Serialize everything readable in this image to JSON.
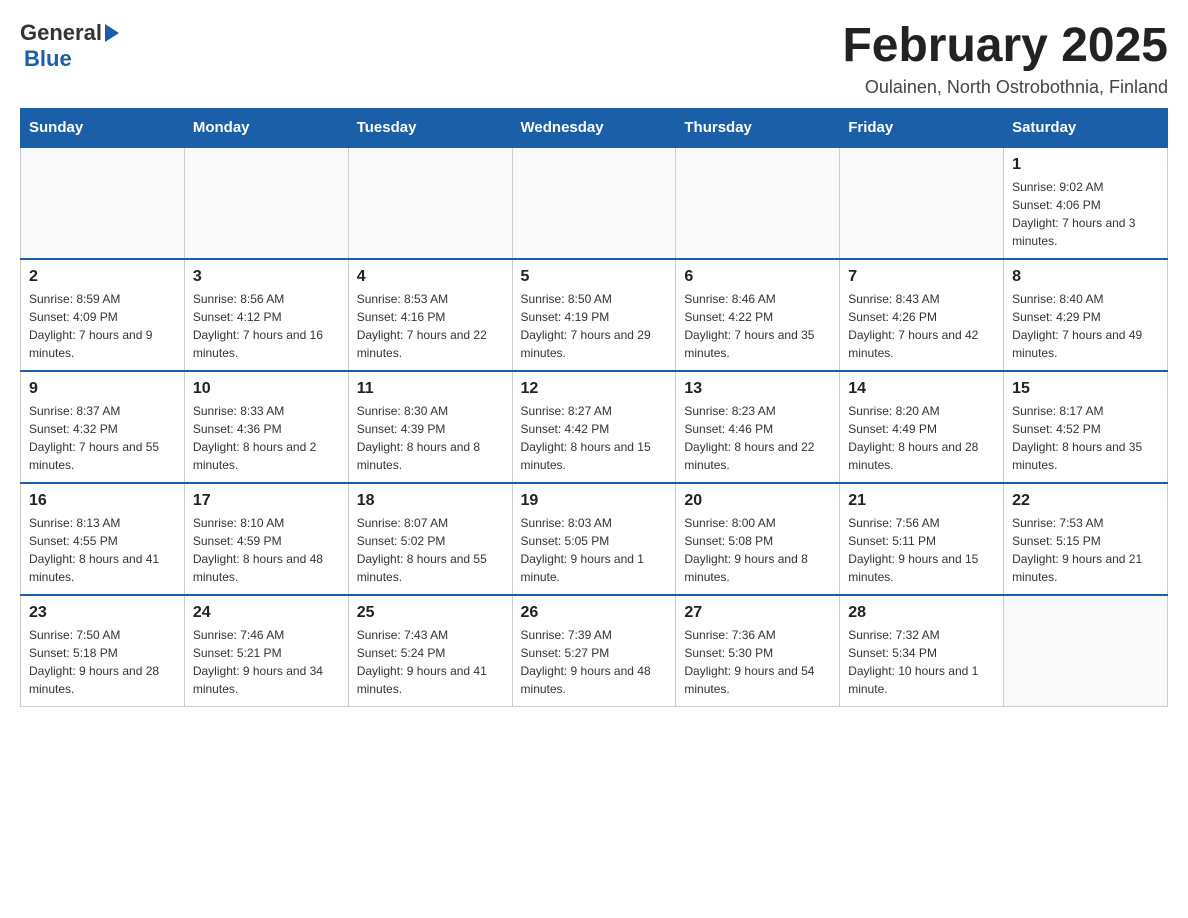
{
  "header": {
    "logo_general": "General",
    "logo_blue": "Blue",
    "month_title": "February 2025",
    "location": "Oulainen, North Ostrobothnia, Finland"
  },
  "weekdays": [
    "Sunday",
    "Monday",
    "Tuesday",
    "Wednesday",
    "Thursday",
    "Friday",
    "Saturday"
  ],
  "weeks": [
    [
      {
        "day": "",
        "info": ""
      },
      {
        "day": "",
        "info": ""
      },
      {
        "day": "",
        "info": ""
      },
      {
        "day": "",
        "info": ""
      },
      {
        "day": "",
        "info": ""
      },
      {
        "day": "",
        "info": ""
      },
      {
        "day": "1",
        "info": "Sunrise: 9:02 AM\nSunset: 4:06 PM\nDaylight: 7 hours and 3 minutes."
      }
    ],
    [
      {
        "day": "2",
        "info": "Sunrise: 8:59 AM\nSunset: 4:09 PM\nDaylight: 7 hours and 9 minutes."
      },
      {
        "day": "3",
        "info": "Sunrise: 8:56 AM\nSunset: 4:12 PM\nDaylight: 7 hours and 16 minutes."
      },
      {
        "day": "4",
        "info": "Sunrise: 8:53 AM\nSunset: 4:16 PM\nDaylight: 7 hours and 22 minutes."
      },
      {
        "day": "5",
        "info": "Sunrise: 8:50 AM\nSunset: 4:19 PM\nDaylight: 7 hours and 29 minutes."
      },
      {
        "day": "6",
        "info": "Sunrise: 8:46 AM\nSunset: 4:22 PM\nDaylight: 7 hours and 35 minutes."
      },
      {
        "day": "7",
        "info": "Sunrise: 8:43 AM\nSunset: 4:26 PM\nDaylight: 7 hours and 42 minutes."
      },
      {
        "day": "8",
        "info": "Sunrise: 8:40 AM\nSunset: 4:29 PM\nDaylight: 7 hours and 49 minutes."
      }
    ],
    [
      {
        "day": "9",
        "info": "Sunrise: 8:37 AM\nSunset: 4:32 PM\nDaylight: 7 hours and 55 minutes."
      },
      {
        "day": "10",
        "info": "Sunrise: 8:33 AM\nSunset: 4:36 PM\nDaylight: 8 hours and 2 minutes."
      },
      {
        "day": "11",
        "info": "Sunrise: 8:30 AM\nSunset: 4:39 PM\nDaylight: 8 hours and 8 minutes."
      },
      {
        "day": "12",
        "info": "Sunrise: 8:27 AM\nSunset: 4:42 PM\nDaylight: 8 hours and 15 minutes."
      },
      {
        "day": "13",
        "info": "Sunrise: 8:23 AM\nSunset: 4:46 PM\nDaylight: 8 hours and 22 minutes."
      },
      {
        "day": "14",
        "info": "Sunrise: 8:20 AM\nSunset: 4:49 PM\nDaylight: 8 hours and 28 minutes."
      },
      {
        "day": "15",
        "info": "Sunrise: 8:17 AM\nSunset: 4:52 PM\nDaylight: 8 hours and 35 minutes."
      }
    ],
    [
      {
        "day": "16",
        "info": "Sunrise: 8:13 AM\nSunset: 4:55 PM\nDaylight: 8 hours and 41 minutes."
      },
      {
        "day": "17",
        "info": "Sunrise: 8:10 AM\nSunset: 4:59 PM\nDaylight: 8 hours and 48 minutes."
      },
      {
        "day": "18",
        "info": "Sunrise: 8:07 AM\nSunset: 5:02 PM\nDaylight: 8 hours and 55 minutes."
      },
      {
        "day": "19",
        "info": "Sunrise: 8:03 AM\nSunset: 5:05 PM\nDaylight: 9 hours and 1 minute."
      },
      {
        "day": "20",
        "info": "Sunrise: 8:00 AM\nSunset: 5:08 PM\nDaylight: 9 hours and 8 minutes."
      },
      {
        "day": "21",
        "info": "Sunrise: 7:56 AM\nSunset: 5:11 PM\nDaylight: 9 hours and 15 minutes."
      },
      {
        "day": "22",
        "info": "Sunrise: 7:53 AM\nSunset: 5:15 PM\nDaylight: 9 hours and 21 minutes."
      }
    ],
    [
      {
        "day": "23",
        "info": "Sunrise: 7:50 AM\nSunset: 5:18 PM\nDaylight: 9 hours and 28 minutes."
      },
      {
        "day": "24",
        "info": "Sunrise: 7:46 AM\nSunset: 5:21 PM\nDaylight: 9 hours and 34 minutes."
      },
      {
        "day": "25",
        "info": "Sunrise: 7:43 AM\nSunset: 5:24 PM\nDaylight: 9 hours and 41 minutes."
      },
      {
        "day": "26",
        "info": "Sunrise: 7:39 AM\nSunset: 5:27 PM\nDaylight: 9 hours and 48 minutes."
      },
      {
        "day": "27",
        "info": "Sunrise: 7:36 AM\nSunset: 5:30 PM\nDaylight: 9 hours and 54 minutes."
      },
      {
        "day": "28",
        "info": "Sunrise: 7:32 AM\nSunset: 5:34 PM\nDaylight: 10 hours and 1 minute."
      },
      {
        "day": "",
        "info": ""
      }
    ]
  ]
}
